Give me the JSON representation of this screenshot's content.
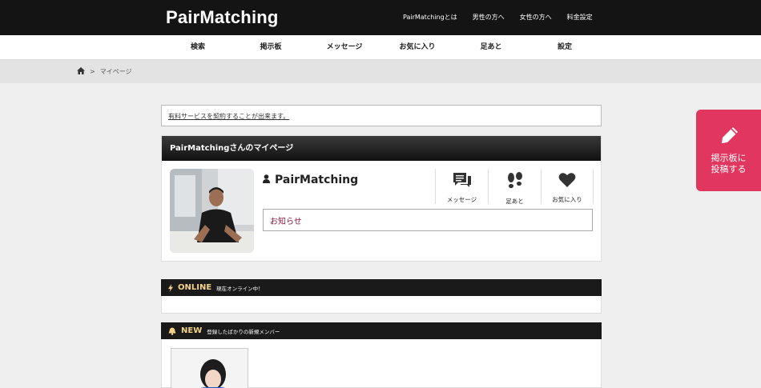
{
  "header": {
    "logo": "PairMatching",
    "links": [
      "PairMatchingとは",
      "男性の方へ",
      "女性の方へ",
      "料金設定"
    ]
  },
  "nav": {
    "items": [
      "検索",
      "掲示板",
      "メッセージ",
      "お気に入り",
      "足あと",
      "設定"
    ]
  },
  "breadcrumb": {
    "separator": ">",
    "current": "マイページ"
  },
  "notice": {
    "link": "有料サービスを契約することが出来ます。"
  },
  "mypage": {
    "title": "PairMatchingさんのマイページ",
    "username": "PairMatching",
    "actions": [
      "メッセージ",
      "足あと",
      "お気に入り"
    ],
    "news_label": "お知らせ"
  },
  "online": {
    "title": "ONLINE",
    "subtitle": "現在オンライン中！"
  },
  "new_members": {
    "title": "NEW",
    "subtitle": "登録したばかりの新規メンバー"
  },
  "post_button": {
    "line1": "掲示板に",
    "line2": "投稿する"
  },
  "colors": {
    "header_bg": "#141414",
    "accent_pink": "#e0365f",
    "section_title": "#f5d28a",
    "news_text": "#8b1a3a"
  },
  "icons": [
    "home-icon",
    "user-icon",
    "message-icon",
    "footprints-icon",
    "heart-icon",
    "bolt-icon",
    "bell-icon",
    "pencil-icon"
  ]
}
